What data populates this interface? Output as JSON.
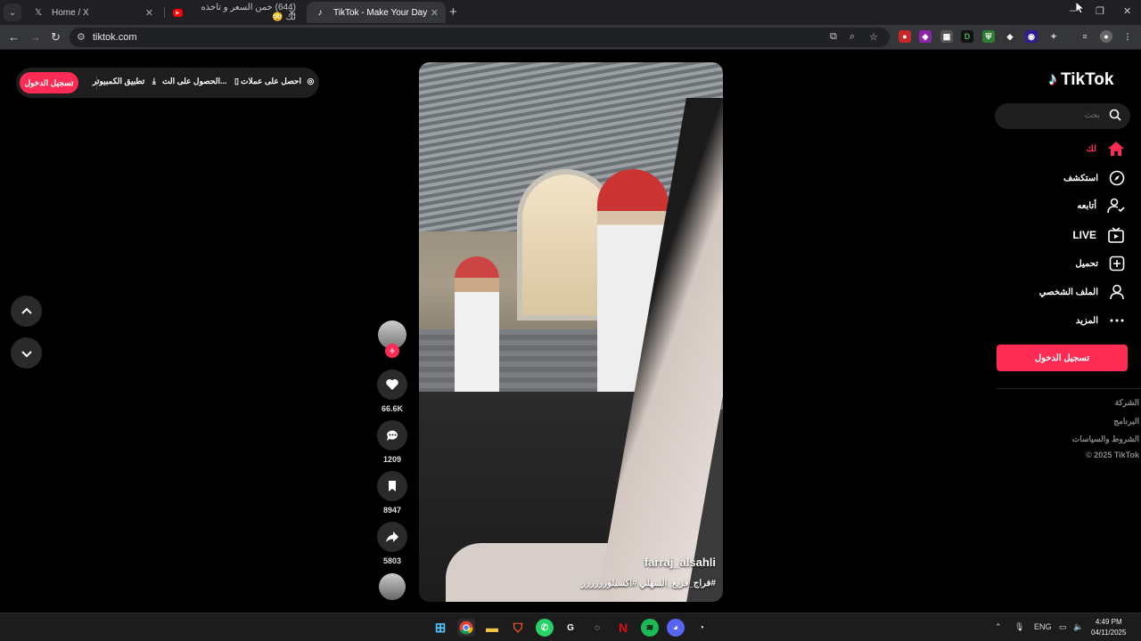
{
  "browser": {
    "tabs": [
      {
        "title": "Home / X",
        "favicon": "x-logo-icon"
      },
      {
        "title": "(644) خمن السعر و تاخذه لك 😳",
        "favicon": "youtube-icon"
      },
      {
        "title": "TikTok - Make Your Day",
        "favicon": "tiktok-icon",
        "active": true
      }
    ],
    "url": "tiktok.com"
  },
  "topbar": {
    "coins": "احصل على عملات",
    "get_app": "الحصول على الت...",
    "desktop_app": "تطبيق الكمبيوتر",
    "login": "تسجيل الدخول"
  },
  "video": {
    "author": "farraj_alsahli",
    "caption": "#فراج_فزيع_السهلي #اكسبلورررررر"
  },
  "actions": {
    "likes": "66.6K",
    "comments": "1209",
    "saves": "8947",
    "shares": "5803"
  },
  "sidebar": {
    "logo": "TikTok",
    "search_placeholder": "بحث",
    "nav": [
      {
        "label": "لك",
        "icon": "home-icon",
        "active": true
      },
      {
        "label": "استكشف",
        "icon": "compass-icon"
      },
      {
        "label": "أتابعه",
        "icon": "following-icon"
      },
      {
        "label": "LIVE",
        "icon": "live-tv-icon"
      },
      {
        "label": "تحميل",
        "icon": "upload-plus-icon"
      },
      {
        "label": "الملف الشخصي",
        "icon": "profile-icon"
      },
      {
        "label": "المزيد",
        "icon": "more-dots-icon"
      }
    ],
    "login": "تسجيل الدخول",
    "footer": [
      "الشركة",
      "البرنامج",
      "الشروط والسياسات",
      "© 2025 TikTok"
    ]
  },
  "taskbar": {
    "language": "ENG",
    "time": "4:49 PM",
    "date": "04/11/2025"
  },
  "colors": {
    "accent": "#fe2c55",
    "background": "#000000"
  }
}
